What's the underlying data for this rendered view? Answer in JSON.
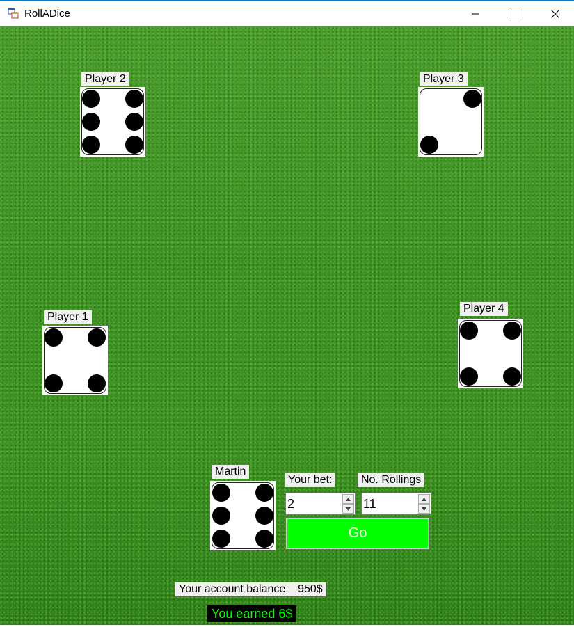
{
  "window": {
    "title": "RollADice",
    "icon": "app-window-icon",
    "controls": {
      "minimize": "minimize-icon",
      "maximize": "maximize-icon",
      "close": "close-icon"
    }
  },
  "players": [
    {
      "id": "player-2",
      "label": "Player 2",
      "die_value": 6
    },
    {
      "id": "player-3",
      "label": "Player 3",
      "die_value": 2
    },
    {
      "id": "player-1",
      "label": "Player 1",
      "die_value": 4
    },
    {
      "id": "player-4",
      "label": "Player 4",
      "die_value": 4
    },
    {
      "id": "human",
      "label": "Martin",
      "die_value": 6
    }
  ],
  "controls": {
    "bet_label": "Your bet:",
    "bet_value": "2",
    "rollings_label": "No. Rollings",
    "rollings_value": "11",
    "go_label": "Go"
  },
  "status": {
    "balance_label": "Your account balance:",
    "balance_value": "950$",
    "earned_message": "You earned 6$"
  },
  "colors": {
    "go_button": "#00ff00",
    "earned_text": "#00ff00",
    "earned_background": "#000000",
    "table": "#3a8f22"
  }
}
